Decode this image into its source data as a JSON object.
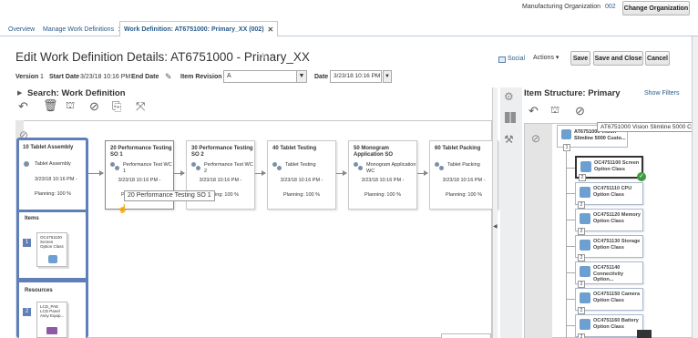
{
  "header": {
    "org_label": "Manufacturing Organization",
    "org_value": "002",
    "change_org_label": "Change Organization"
  },
  "tabs": [
    {
      "label": "Overview"
    },
    {
      "label": "Manage Work Definitions"
    },
    {
      "label": "Work Definition: AT6751000: Primary_XX (002)"
    }
  ],
  "page": {
    "title": "Edit Work Definition Details: AT6751000 - Primary_XX",
    "social": "Social",
    "actions": "Actions",
    "save": "Save",
    "save_close": "Save and Close",
    "cancel": "Cancel"
  },
  "details": {
    "version_label": "Version",
    "version_value": "1",
    "start_date_label": "Start Date",
    "start_date_value": "3/23/18 10:16 PM",
    "end_date_label": "End Date",
    "item_revision_label": "Item Revision",
    "item_revision_value": "A",
    "date_label": "Date",
    "date_value": "3/23/18 10:16 PM"
  },
  "search": {
    "title": "Search: Work Definition"
  },
  "operations": [
    {
      "title": "10 Tablet Assembly",
      "wc": "Tablet Assembly",
      "date": "3/23/18 10:16 PM -",
      "planning": "Planning: 100 %"
    },
    {
      "title": "20 Performance Testing SO 1",
      "wc": "Performance Test WC 1",
      "date": "3/23/18 10:16 PM -",
      "planning": "Planning: 100 %"
    },
    {
      "title": "30 Performance Testing SO 2",
      "wc": "Performance Test WC 2",
      "date": "3/23/18 10:16 PM -",
      "planning": "Planning: 100 %"
    },
    {
      "title": "40 Tablet Testing",
      "wc": "Tablet Testing",
      "date": "3/23/18 10:16 PM -",
      "planning": "Planning: 100 %"
    },
    {
      "title": "50 Monogram Application SO",
      "wc": "Monogram Application WC",
      "date": "3/23/18 10:16 PM -",
      "planning": "Planning: 100 %"
    },
    {
      "title": "60 Tablet Packing",
      "wc": "Tablet Packing",
      "date": "3/23/18 10:16 PM -",
      "planning": "Planning: 100 %"
    }
  ],
  "tooltip_op": "20 Performance Testing SO 1",
  "items": {
    "title": "Items",
    "badge": "1",
    "card_text": "OC4751100 Screen Option Class"
  },
  "resources": {
    "title": "Resources",
    "badge": "2",
    "card_text": "LCD_PAE LCD Panel Assy Equip..."
  },
  "item_structure": {
    "title": "Item Structure: Primary",
    "show_filters": "Show Filters",
    "root": "AT6751000 Vision Slimline 5000 Custo...",
    "tooltip": "AT6751000 Vision Slimline 5000 Custo",
    "root_num": "1",
    "classes": [
      {
        "name": "OC4751100 Screen Option Class",
        "num": "2"
      },
      {
        "name": "OC4751110 CPU Option Class",
        "num": "2"
      },
      {
        "name": "OC4751120 Memory Option Class",
        "num": "2"
      },
      {
        "name": "OC4751130 Storage Option Class",
        "num": "2"
      },
      {
        "name": "OC4751140 Connectivity Option...",
        "num": "2"
      },
      {
        "name": "OC4751150 Camera Option Class",
        "num": "2"
      },
      {
        "name": "OC4751160 Battery Option Class",
        "num": "2"
      }
    ]
  },
  "colors": {
    "accent_blue": "#2a5a8a",
    "panel_blue": "#5f7fb8",
    "check_green": "#3e9a3e"
  }
}
